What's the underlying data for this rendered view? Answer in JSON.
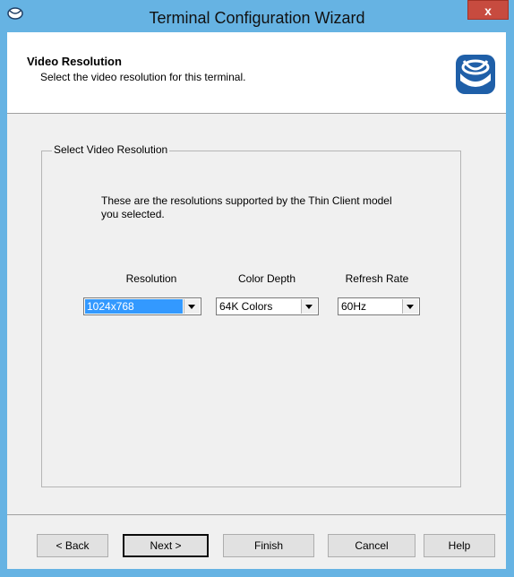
{
  "window": {
    "title": "Terminal Configuration Wizard",
    "close_label": "x"
  },
  "header": {
    "title": "Video Resolution",
    "subtitle": "Select the video resolution for this terminal.",
    "logo_icon": "thinmanager-logo-icon"
  },
  "group": {
    "legend": "Select Video Resolution",
    "info": "These are the resolutions supported by the Thin Client model you selected."
  },
  "fields": {
    "resolution": {
      "label": "Resolution",
      "value": "1024x768"
    },
    "color_depth": {
      "label": "Color Depth",
      "value": "64K Colors"
    },
    "refresh_rate": {
      "label": "Refresh Rate",
      "value": "60Hz"
    }
  },
  "buttons": {
    "back": "< Back",
    "next": "Next >",
    "finish": "Finish",
    "cancel": "Cancel",
    "help": "Help"
  },
  "colors": {
    "frame": "#66b3e3",
    "close": "#c74b3f",
    "selection": "#3399ff",
    "logo": "#1f5fa8"
  }
}
